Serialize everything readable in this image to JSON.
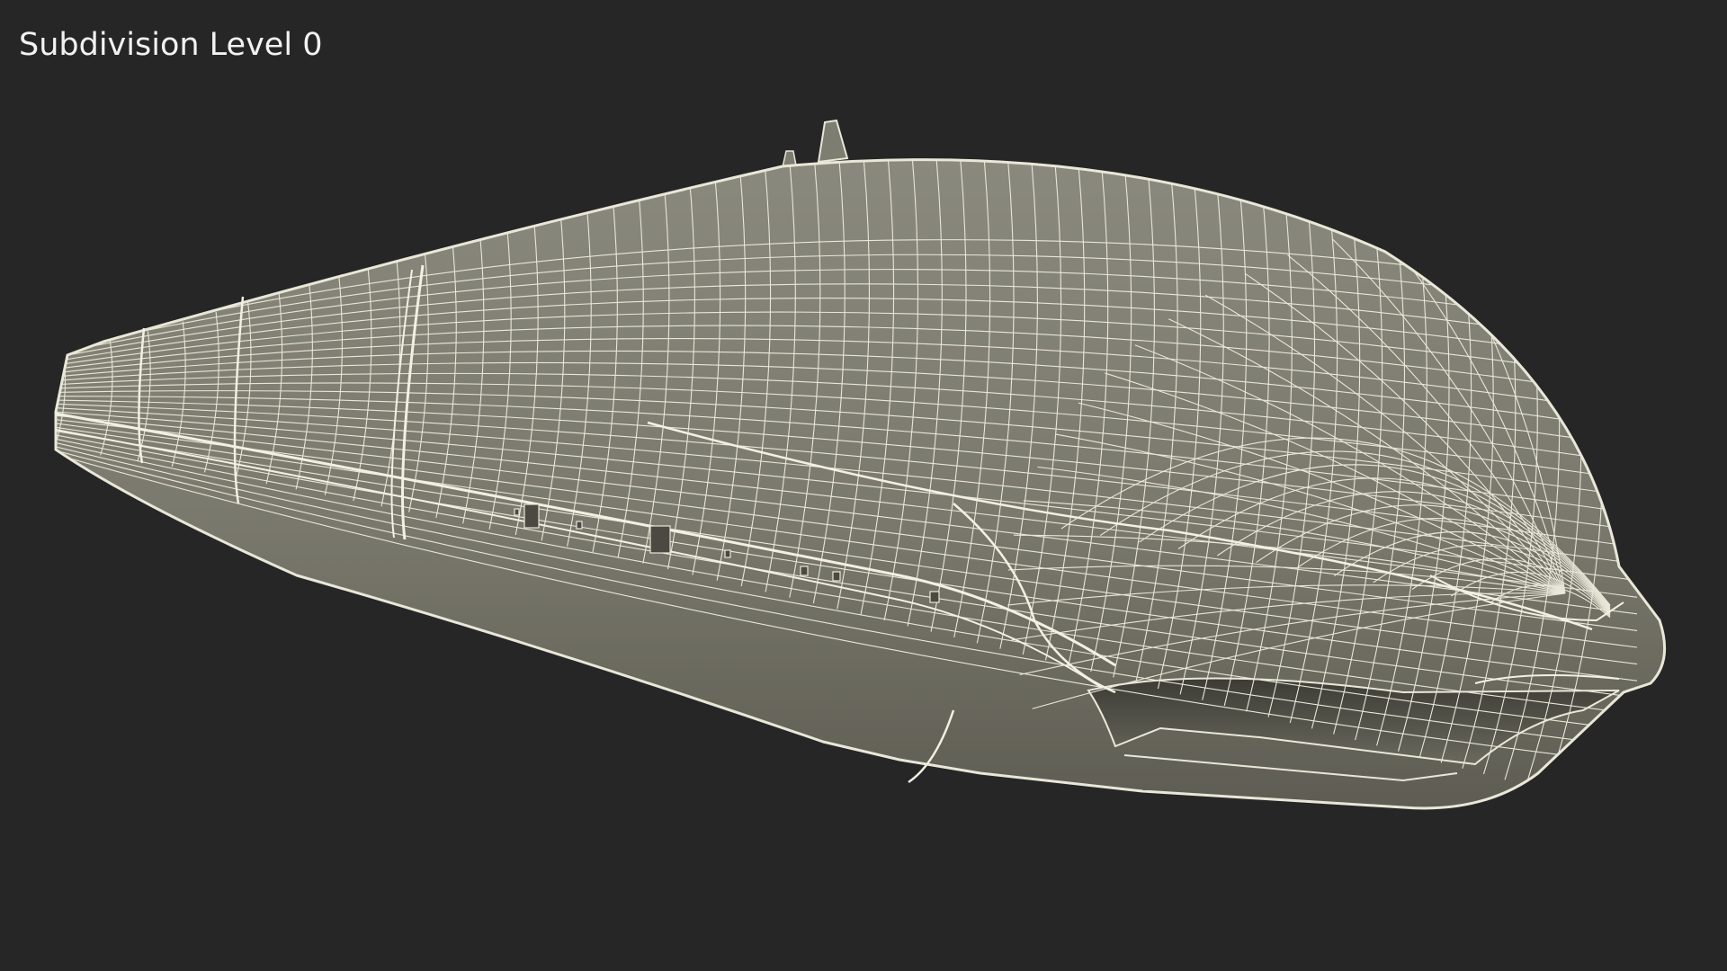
{
  "viewport": {
    "overlay_label": "Subdivision Level 0",
    "background_color": "#262626"
  },
  "model": {
    "surface_color": "#7d7c70",
    "surface_shadow_color": "#5b5a50",
    "wire_color": "#e8e7d8",
    "icon": "maglev-train-wireframe"
  }
}
